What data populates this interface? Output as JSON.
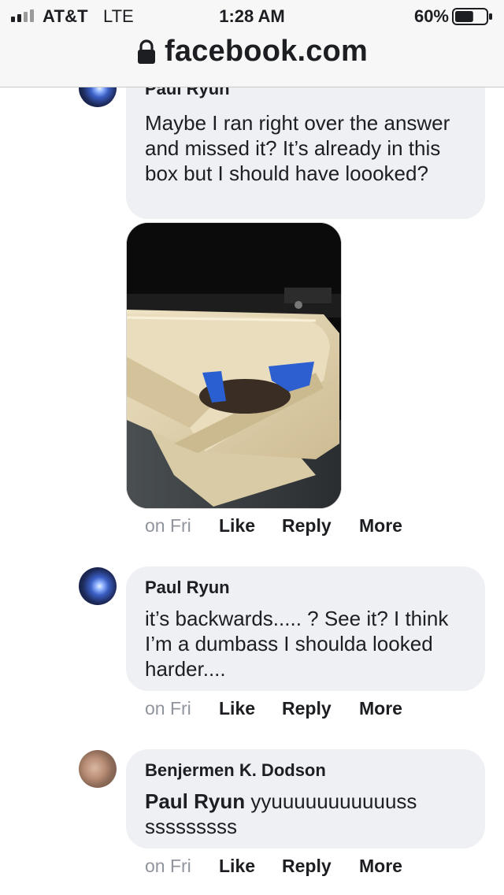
{
  "status_bar": {
    "carrier": "AT&T",
    "network": "LTE",
    "time": "1:28 AM",
    "battery_percent": "60%",
    "battery_level": 0.6
  },
  "url_bar": {
    "domain": "facebook.com"
  },
  "comments": [
    {
      "author": "Paul Ryun",
      "text": "Maybe I ran right over the answer and missed it? It’s already in this box but I should have loooked?",
      "photo_icon": "photo-attachment",
      "time": "on Fri",
      "like": "Like",
      "reply": "Reply",
      "more": "More"
    },
    {
      "author": "Paul Ryun",
      "text": "it’s backwards..... ? See it? I think I’m a dumbass I shoulda looked harder....",
      "time": "on Fri",
      "like": "Like",
      "reply": "Reply",
      "more": "More"
    },
    {
      "author": "Benjermen K. Dodson",
      "mention": "Paul Ryun",
      "text": "yyuuuuuuuuuuuss sssssssss",
      "time": "on Fri",
      "like": "Like",
      "reply": "Reply",
      "more": "More"
    }
  ],
  "colors": {
    "bubble": "#eff0f4",
    "muted": "#90949c",
    "text": "#1c1e21"
  }
}
